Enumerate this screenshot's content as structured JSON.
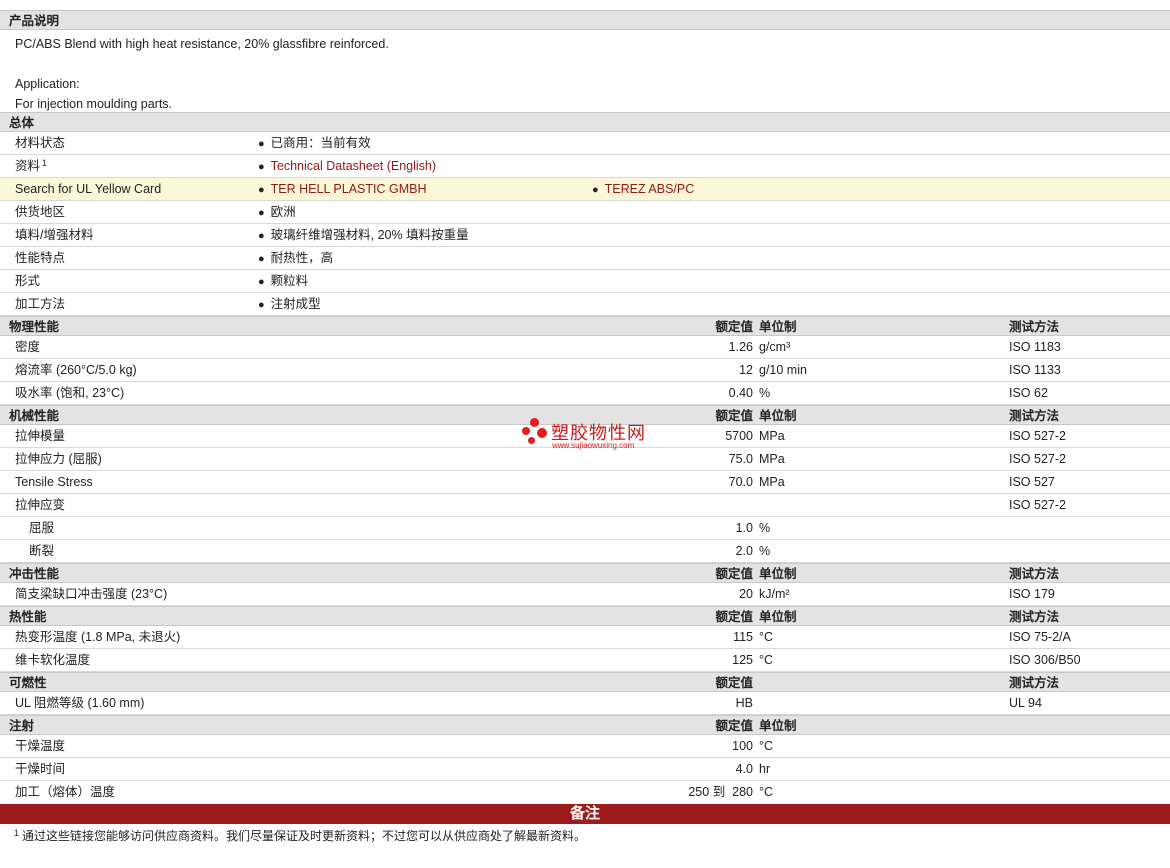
{
  "product_description": {
    "heading": "产品说明",
    "line1": "PC/ABS Blend with high heat resistance, 20% glassfibre reinforced.",
    "line2": "Application:",
    "line3": "For injection moulding parts."
  },
  "general": {
    "heading": "总体",
    "rows": [
      {
        "label": "材料状态",
        "value": "已商用：当前有效"
      },
      {
        "label": "资料",
        "sup": "1",
        "value": "Technical Datasheet (English)"
      },
      {
        "label": "Search for UL Yellow Card",
        "value": "TER HELL PLASTIC GMBH",
        "value2": "TEREZ ABS/PC"
      },
      {
        "label": "供货地区",
        "value": "欧洲"
      },
      {
        "label": "填料/增强材料",
        "value": "玻璃纤维增强材料, 20% 填料按重量"
      },
      {
        "label": "性能特点",
        "value": "耐热性，高"
      },
      {
        "label": "形式",
        "value": "颗粒料"
      },
      {
        "label": "加工方法",
        "value": "注射成型"
      }
    ]
  },
  "col_headers": {
    "value": "额定值",
    "unit": "单位制",
    "test": "测试方法"
  },
  "physical": {
    "heading": "物理性能",
    "rows": [
      {
        "label": "密度",
        "value": "1.26",
        "unit": "g/cm³",
        "test": "ISO 1183"
      },
      {
        "label": "熔流率 (260°C/5.0 kg)",
        "value": "12",
        "unit": "g/10 min",
        "test": "ISO 1133"
      },
      {
        "label": "吸水率 (饱和, 23°C)",
        "value": "0.40",
        "unit": "%",
        "test": "ISO 62"
      }
    ]
  },
  "mechanical": {
    "heading": "机械性能",
    "rows": [
      {
        "label": "拉伸模量",
        "value": "5700",
        "unit": "MPa",
        "test": "ISO 527-2"
      },
      {
        "label": "拉伸应力 (屈服)",
        "value": "75.0",
        "unit": "MPa",
        "test": "ISO 527-2"
      },
      {
        "label": "Tensile Stress",
        "value": "70.0",
        "unit": "MPa",
        "test": "ISO 527"
      },
      {
        "label": "拉伸应变",
        "value": "",
        "unit": "",
        "test": "ISO 527-2"
      },
      {
        "label": "屈服",
        "value": "1.0",
        "unit": "%",
        "test": ""
      },
      {
        "label": "断裂",
        "value": "2.0",
        "unit": "%",
        "test": ""
      }
    ]
  },
  "impact": {
    "heading": "冲击性能",
    "rows": [
      {
        "label": "简支梁缺口冲击强度 (23°C)",
        "value": "20",
        "unit": "kJ/m²",
        "test": "ISO 179"
      }
    ]
  },
  "thermal": {
    "heading": "热性能",
    "rows": [
      {
        "label": "热变形温度 (1.8 MPa, 未退火)",
        "value": "115",
        "unit": "°C",
        "test": "ISO 75-2/A"
      },
      {
        "label": "维卡软化温度",
        "value": "125",
        "unit": "°C",
        "test": "ISO 306/B50"
      }
    ]
  },
  "flammability": {
    "heading": "可燃性",
    "rows": [
      {
        "label": "UL 阻燃等级 (1.60 mm)",
        "value": "HB",
        "test": "UL 94"
      }
    ]
  },
  "injection": {
    "heading": "注射",
    "rows": [
      {
        "label": "干燥温度",
        "value": "100",
        "unit": "°C"
      },
      {
        "label": "干燥时间",
        "value": "4.0",
        "unit": "hr"
      },
      {
        "label": "加工（熔体）温度",
        "value": "250 到  280",
        "unit": "°C"
      }
    ]
  },
  "notes": {
    "heading": "备注",
    "sup": "1",
    "text": "通过这些链接您能够访问供应商资料。我们尽量保证及时更新资料；不过您可以从供应商处了解最新资料。"
  },
  "watermark": {
    "title": "塑胶物性网",
    "url": "www.sujiaowuxing.com"
  }
}
